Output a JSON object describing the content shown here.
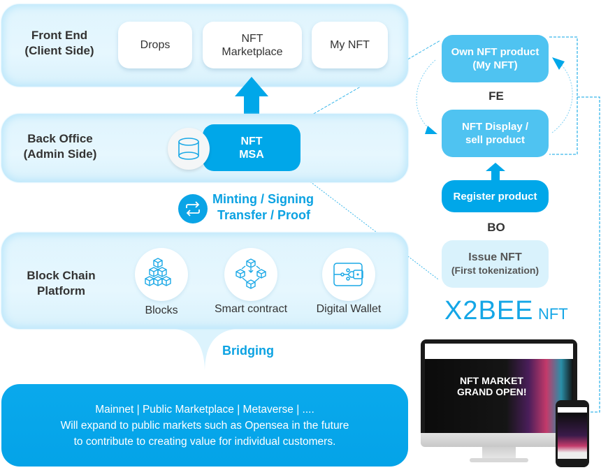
{
  "front_end": {
    "title": "Front End\n(Client Side)",
    "cards": [
      "Drops",
      "NFT\nMarketplace",
      "My NFT"
    ]
  },
  "back_office": {
    "title": "Back Office\n(Admin Side)",
    "msa_label": "NFT\nMSA",
    "db_icon": "database-icon"
  },
  "operations": {
    "icon": "sync-arrows-icon",
    "line1": "Minting / Signing",
    "line2": "Transfer / Proof"
  },
  "block_chain": {
    "title": "Block Chain\nPlatform",
    "items": [
      {
        "icon": "blocks-icon",
        "label": "Blocks"
      },
      {
        "icon": "smart-contract-icon",
        "label": "Smart contract"
      },
      {
        "icon": "digital-wallet-icon",
        "label": "Digital Wallet"
      }
    ]
  },
  "bridging": {
    "label": "Bridging"
  },
  "bottom": {
    "line1": "Mainnet | Public Marketplace | Metaverse | ....",
    "line2": "Will expand to public markets such as Opensea in the future",
    "line3": "to contribute to creating value for individual customers."
  },
  "flow": {
    "own_nft": "Own NFT product\n(My NFT)",
    "fe_label": "FE",
    "display_sell": "NFT Display /\nsell product",
    "register": "Register product",
    "bo_label": "BO",
    "issue_line1": "Issue NFT",
    "issue_line2": "(First tokenization)"
  },
  "logo": {
    "brand": "X2BEE",
    "suffix": "NFT"
  },
  "mockup": {
    "headline_line1": "NFT MARKET",
    "headline_line2": "GRAND OPEN!"
  },
  "colors": {
    "primary": "#00a7e9",
    "light_box": "#4fc3f1",
    "pale_box": "#d9f2fc",
    "text_dark": "#333333"
  }
}
